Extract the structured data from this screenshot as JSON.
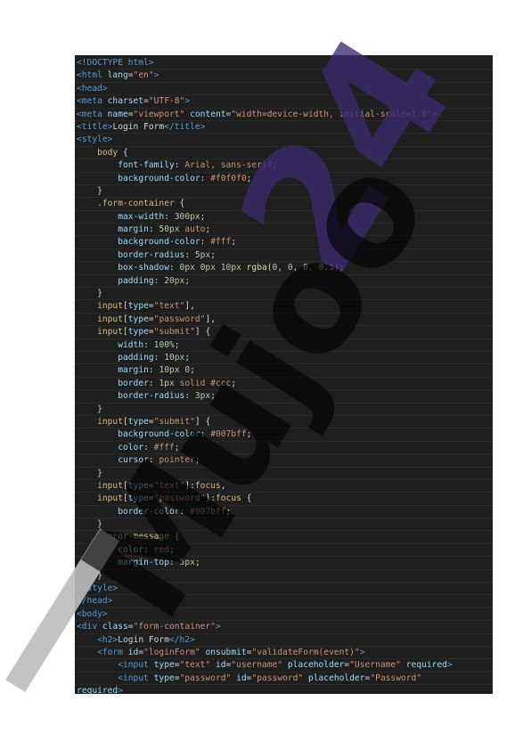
{
  "watermark": {
    "main_text": "Mujoo",
    "number_text": "24",
    "colors": {
      "main": "#000000",
      "number": "#3c2a6e",
      "bar": "#bdbdbd"
    }
  },
  "code": {
    "lines": [
      [
        [
          "tag",
          "<!DOCTYPE html>"
        ]
      ],
      [
        [
          "tag",
          "<html "
        ],
        [
          "attr",
          "lang"
        ],
        [
          "punc",
          "="
        ],
        [
          "str",
          "\"en\""
        ],
        [
          "tag",
          ">"
        ]
      ],
      [
        [
          "tag",
          "<head>"
        ]
      ],
      [
        [
          "tag",
          "<meta "
        ],
        [
          "attr",
          "charset"
        ],
        [
          "punc",
          "="
        ],
        [
          "str",
          "\"UTF-8\""
        ],
        [
          "tag",
          ">"
        ]
      ],
      [
        [
          "tag",
          "<meta "
        ],
        [
          "attr",
          "name"
        ],
        [
          "punc",
          "="
        ],
        [
          "str",
          "\"viewport\""
        ],
        [
          "text",
          " "
        ],
        [
          "attr",
          "content"
        ],
        [
          "punc",
          "="
        ],
        [
          "str",
          "\"width=device-width, initial-scale=1.0\""
        ],
        [
          "tag",
          ">"
        ]
      ],
      [
        [
          "tag",
          "<title>"
        ],
        [
          "text",
          "Login Form"
        ],
        [
          "tag",
          "</title>"
        ]
      ],
      [
        [
          "tag",
          "<style>"
        ]
      ],
      [
        [
          "text",
          "    "
        ],
        [
          "sel",
          "body"
        ],
        [
          "punc",
          " {"
        ]
      ],
      [
        [
          "text",
          "        "
        ],
        [
          "prop",
          "font-family"
        ],
        [
          "punc",
          ": "
        ],
        [
          "val",
          "Arial, sans-serif"
        ],
        [
          "punc",
          ";"
        ]
      ],
      [
        [
          "text",
          "        "
        ],
        [
          "prop",
          "background-color"
        ],
        [
          "punc",
          ": "
        ],
        [
          "val",
          "#f0f0f0"
        ],
        [
          "punc",
          ";"
        ]
      ],
      [
        [
          "text",
          "    "
        ],
        [
          "punc",
          "}"
        ]
      ],
      [
        [
          "text",
          "    "
        ],
        [
          "sel",
          ".form-container"
        ],
        [
          "punc",
          " {"
        ]
      ],
      [
        [
          "text",
          "        "
        ],
        [
          "prop",
          "max-width"
        ],
        [
          "punc",
          ": "
        ],
        [
          "num",
          "300px"
        ],
        [
          "punc",
          ";"
        ]
      ],
      [
        [
          "text",
          "        "
        ],
        [
          "prop",
          "margin"
        ],
        [
          "punc",
          ": "
        ],
        [
          "num",
          "50px"
        ],
        [
          "val",
          " auto"
        ],
        [
          "punc",
          ";"
        ]
      ],
      [
        [
          "text",
          "        "
        ],
        [
          "prop",
          "background-color"
        ],
        [
          "punc",
          ": "
        ],
        [
          "val",
          "#fff"
        ],
        [
          "punc",
          ";"
        ]
      ],
      [
        [
          "text",
          "        "
        ],
        [
          "prop",
          "border-radius"
        ],
        [
          "punc",
          ": "
        ],
        [
          "num",
          "5px"
        ],
        [
          "punc",
          ";"
        ]
      ],
      [
        [
          "text",
          "        "
        ],
        [
          "prop",
          "box-shadow"
        ],
        [
          "punc",
          ": "
        ],
        [
          "num",
          "0px 0px 10px"
        ],
        [
          "text",
          " "
        ],
        [
          "kw",
          "rgba"
        ],
        [
          "punc",
          "("
        ],
        [
          "num",
          "0, 0, 0, 0.1"
        ],
        [
          "punc",
          ");"
        ]
      ],
      [
        [
          "text",
          "        "
        ],
        [
          "prop",
          "padding"
        ],
        [
          "punc",
          ": "
        ],
        [
          "num",
          "20px"
        ],
        [
          "punc",
          ";"
        ]
      ],
      [
        [
          "text",
          "    "
        ],
        [
          "punc",
          "}"
        ]
      ],
      [
        [
          "text",
          "    "
        ],
        [
          "sel",
          "input"
        ],
        [
          "punc",
          "["
        ],
        [
          "attr",
          "type"
        ],
        [
          "punc",
          "="
        ],
        [
          "str",
          "\"text\""
        ],
        [
          "punc",
          "],"
        ]
      ],
      [
        [
          "text",
          "    "
        ],
        [
          "sel",
          "input"
        ],
        [
          "punc",
          "["
        ],
        [
          "attr",
          "type"
        ],
        [
          "punc",
          "="
        ],
        [
          "str",
          "\"password\""
        ],
        [
          "punc",
          "],"
        ]
      ],
      [
        [
          "text",
          "    "
        ],
        [
          "sel",
          "input"
        ],
        [
          "punc",
          "["
        ],
        [
          "attr",
          "type"
        ],
        [
          "punc",
          "="
        ],
        [
          "str",
          "\"submit\""
        ],
        [
          "punc",
          "] {"
        ]
      ],
      [
        [
          "text",
          "        "
        ],
        [
          "prop",
          "width"
        ],
        [
          "punc",
          ": "
        ],
        [
          "num",
          "100%"
        ],
        [
          "punc",
          ";"
        ]
      ],
      [
        [
          "text",
          "        "
        ],
        [
          "prop",
          "padding"
        ],
        [
          "punc",
          ": "
        ],
        [
          "num",
          "10px"
        ],
        [
          "punc",
          ";"
        ]
      ],
      [
        [
          "text",
          "        "
        ],
        [
          "prop",
          "margin"
        ],
        [
          "punc",
          ": "
        ],
        [
          "num",
          "10px 0"
        ],
        [
          "punc",
          ";"
        ]
      ],
      [
        [
          "text",
          "        "
        ],
        [
          "prop",
          "border"
        ],
        [
          "punc",
          ": "
        ],
        [
          "num",
          "1px"
        ],
        [
          "val",
          " solid #ccc"
        ],
        [
          "punc",
          ";"
        ]
      ],
      [
        [
          "text",
          "        "
        ],
        [
          "prop",
          "border-radius"
        ],
        [
          "punc",
          ": "
        ],
        [
          "num",
          "3px"
        ],
        [
          "punc",
          ";"
        ]
      ],
      [
        [
          "text",
          "    "
        ],
        [
          "punc",
          "}"
        ]
      ],
      [
        [
          "text",
          "    "
        ],
        [
          "sel",
          "input"
        ],
        [
          "punc",
          "["
        ],
        [
          "attr",
          "type"
        ],
        [
          "punc",
          "="
        ],
        [
          "str",
          "\"submit\""
        ],
        [
          "punc",
          "] {"
        ]
      ],
      [
        [
          "text",
          "        "
        ],
        [
          "prop",
          "background-color"
        ],
        [
          "punc",
          ": "
        ],
        [
          "val",
          "#007bff"
        ],
        [
          "punc",
          ";"
        ]
      ],
      [
        [
          "text",
          "        "
        ],
        [
          "prop",
          "color"
        ],
        [
          "punc",
          ": "
        ],
        [
          "val",
          "#fff"
        ],
        [
          "punc",
          ";"
        ]
      ],
      [
        [
          "text",
          "        "
        ],
        [
          "prop",
          "cursor"
        ],
        [
          "punc",
          ": "
        ],
        [
          "val",
          "pointer"
        ],
        [
          "punc",
          ";"
        ]
      ],
      [
        [
          "text",
          "    "
        ],
        [
          "punc",
          "}"
        ]
      ],
      [
        [
          "text",
          "    "
        ],
        [
          "sel",
          "input"
        ],
        [
          "punc",
          "["
        ],
        [
          "attr",
          "type"
        ],
        [
          "punc",
          "="
        ],
        [
          "str",
          "\"text\""
        ],
        [
          "punc",
          "]:"
        ],
        [
          "sel",
          "focus"
        ],
        [
          "punc",
          ","
        ]
      ],
      [
        [
          "text",
          "    "
        ],
        [
          "sel",
          "input"
        ],
        [
          "punc",
          "["
        ],
        [
          "attr",
          "type"
        ],
        [
          "punc",
          "="
        ],
        [
          "str",
          "\"password\""
        ],
        [
          "punc",
          "]:"
        ],
        [
          "sel",
          "focus"
        ],
        [
          "punc",
          " {"
        ]
      ],
      [
        [
          "text",
          "        "
        ],
        [
          "prop",
          "border-color"
        ],
        [
          "punc",
          ": "
        ],
        [
          "val",
          "#007bff"
        ],
        [
          "punc",
          ";"
        ]
      ],
      [
        [
          "text",
          "    "
        ],
        [
          "punc",
          "}"
        ]
      ],
      [
        [
          "text",
          "    "
        ],
        [
          "sel",
          ".error-message"
        ],
        [
          "punc",
          " {"
        ]
      ],
      [
        [
          "text",
          "        "
        ],
        [
          "prop",
          "color"
        ],
        [
          "punc",
          ": "
        ],
        [
          "val",
          "red"
        ],
        [
          "punc",
          ";"
        ]
      ],
      [
        [
          "text",
          "        "
        ],
        [
          "prop",
          "margin-top"
        ],
        [
          "punc",
          ": "
        ],
        [
          "num",
          "5px"
        ],
        [
          "punc",
          ";"
        ]
      ],
      [
        [
          "text",
          "    "
        ],
        [
          "punc",
          "}"
        ]
      ],
      [
        [
          "tag",
          "</style>"
        ]
      ],
      [
        [
          "tag",
          "</head>"
        ]
      ],
      [
        [
          "tag",
          "<body>"
        ]
      ],
      [
        [
          "tag",
          "<div "
        ],
        [
          "attr",
          "class"
        ],
        [
          "punc",
          "="
        ],
        [
          "str",
          "\"form-container\""
        ],
        [
          "tag",
          ">"
        ]
      ],
      [
        [
          "text",
          "    "
        ],
        [
          "tag",
          "<h2>"
        ],
        [
          "text",
          "Login Form"
        ],
        [
          "tag",
          "</h2>"
        ]
      ],
      [
        [
          "text",
          "    "
        ],
        [
          "tag",
          "<form "
        ],
        [
          "attr",
          "id"
        ],
        [
          "punc",
          "="
        ],
        [
          "str",
          "\"loginForm\""
        ],
        [
          "text",
          " "
        ],
        [
          "attr",
          "onsubmit"
        ],
        [
          "punc",
          "="
        ],
        [
          "str",
          "\"validateForm(event)\""
        ],
        [
          "tag",
          ">"
        ]
      ],
      [
        [
          "text",
          "        "
        ],
        [
          "tag",
          "<input "
        ],
        [
          "attr",
          "type"
        ],
        [
          "punc",
          "="
        ],
        [
          "str",
          "\"text\""
        ],
        [
          "text",
          " "
        ],
        [
          "attr",
          "id"
        ],
        [
          "punc",
          "="
        ],
        [
          "str",
          "\"username\""
        ],
        [
          "text",
          " "
        ],
        [
          "attr",
          "placeholder"
        ],
        [
          "punc",
          "="
        ],
        [
          "str",
          "\"Username\""
        ],
        [
          "text",
          " "
        ],
        [
          "attr",
          "required"
        ],
        [
          "tag",
          ">"
        ]
      ],
      [
        [
          "text",
          "        "
        ],
        [
          "tag",
          "<input "
        ],
        [
          "attr",
          "type"
        ],
        [
          "punc",
          "="
        ],
        [
          "str",
          "\"password\""
        ],
        [
          "text",
          " "
        ],
        [
          "attr",
          "id"
        ],
        [
          "punc",
          "="
        ],
        [
          "str",
          "\"password\""
        ],
        [
          "text",
          " "
        ],
        [
          "attr",
          "placeholder"
        ],
        [
          "punc",
          "="
        ],
        [
          "str",
          "\"Password\""
        ]
      ],
      [
        [
          "attr",
          "required"
        ],
        [
          "tag",
          ">"
        ]
      ]
    ]
  }
}
